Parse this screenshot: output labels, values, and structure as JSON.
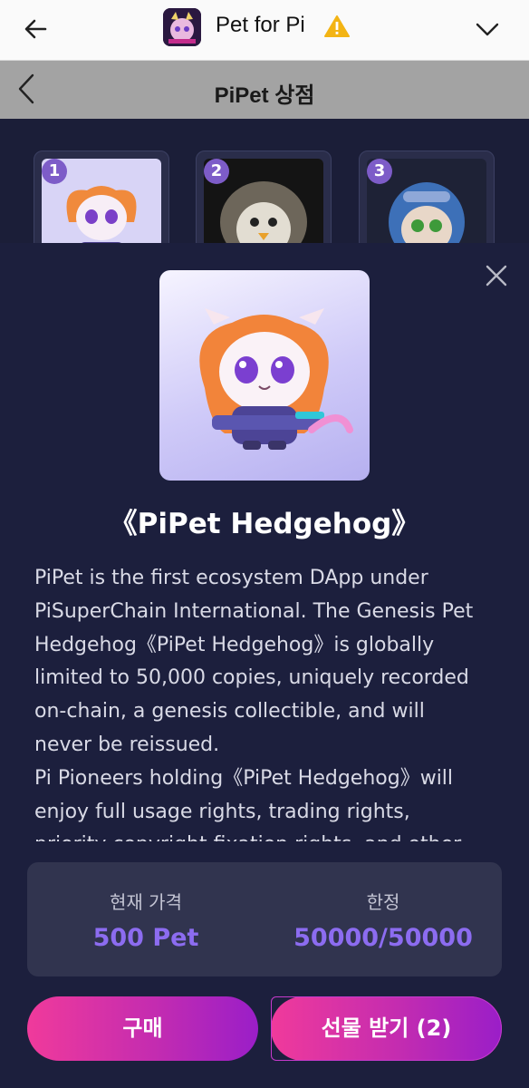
{
  "browser": {
    "title": "Pet for Pi"
  },
  "shop": {
    "title": "PiPet 상점"
  },
  "grid": {
    "cards": [
      {
        "number": "1"
      },
      {
        "number": "2"
      },
      {
        "number": "3"
      }
    ]
  },
  "modal": {
    "pet_title": "《PiPet Hedgehog》",
    "description_lines": [
      "PiPet is the first ecosystem DApp under",
      "PiSuperChain International. The Genesis Pet",
      "Hedgehog《PiPet Hedgehog》is globally",
      "limited to 50,000 copies, uniquely recorded",
      "on-chain, a genesis collectible, and will",
      "never be reissued.",
      "Pi Pioneers holding《PiPet Hedgehog》will",
      "enjoy full usage rights, trading rights,",
      "priority copyright fixation rights, and other"
    ],
    "price_label": "현재 가격",
    "price_value": "500 Pet",
    "limit_label": "한정",
    "limit_value": "50000/50000",
    "buy_label": "구매",
    "gift_label": "선물 받기 (2)"
  },
  "colors": {
    "background": "#1c1f3d",
    "accent_purple": "#8c6cf0",
    "button_gradient_start": "#f03a9b",
    "button_gradient_end": "#9a1ec8"
  },
  "icons": {
    "back": "arrow-left-icon",
    "warning": "warning-icon",
    "dropdown": "chevron-down-icon",
    "shop_back": "chevron-left-icon",
    "close": "close-icon"
  }
}
